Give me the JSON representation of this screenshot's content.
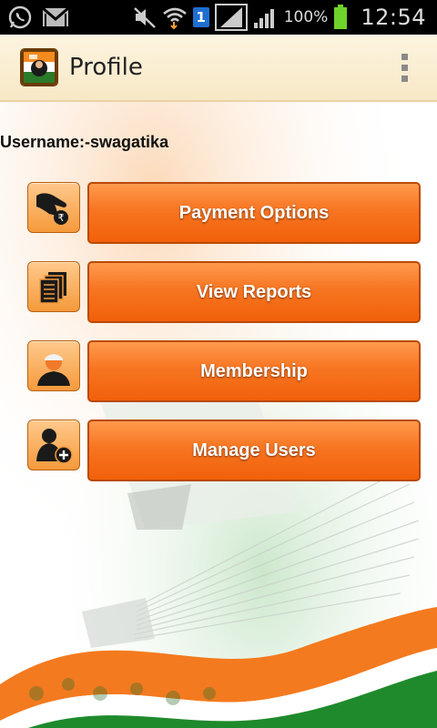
{
  "statusbar": {
    "notification_icons": [
      "whatsapp-icon",
      "gmail-icon"
    ],
    "system_icons": [
      "mute-icon",
      "wifi-icon",
      "sim-badge",
      "signal-icon",
      "signal-icon"
    ],
    "sim_badge": "1",
    "battery_percent": "100%",
    "time": "12:54"
  },
  "actionbar": {
    "title": "Profile"
  },
  "profile": {
    "username_label": "Username:-swagatika"
  },
  "menu": [
    {
      "label": "Payment Options",
      "icon": "hand-rupee-icon"
    },
    {
      "label": "View Reports",
      "icon": "documents-icon"
    },
    {
      "label": "Membership",
      "icon": "person-cap-icon"
    },
    {
      "label": "Manage Users",
      "icon": "add-user-icon"
    }
  ],
  "colors": {
    "button_orange": "#f77521",
    "button_border": "#b94a05",
    "saffron": "#f47a1f",
    "green": "#1f8a2c",
    "actionbar_bg": "#fdf4e0"
  }
}
